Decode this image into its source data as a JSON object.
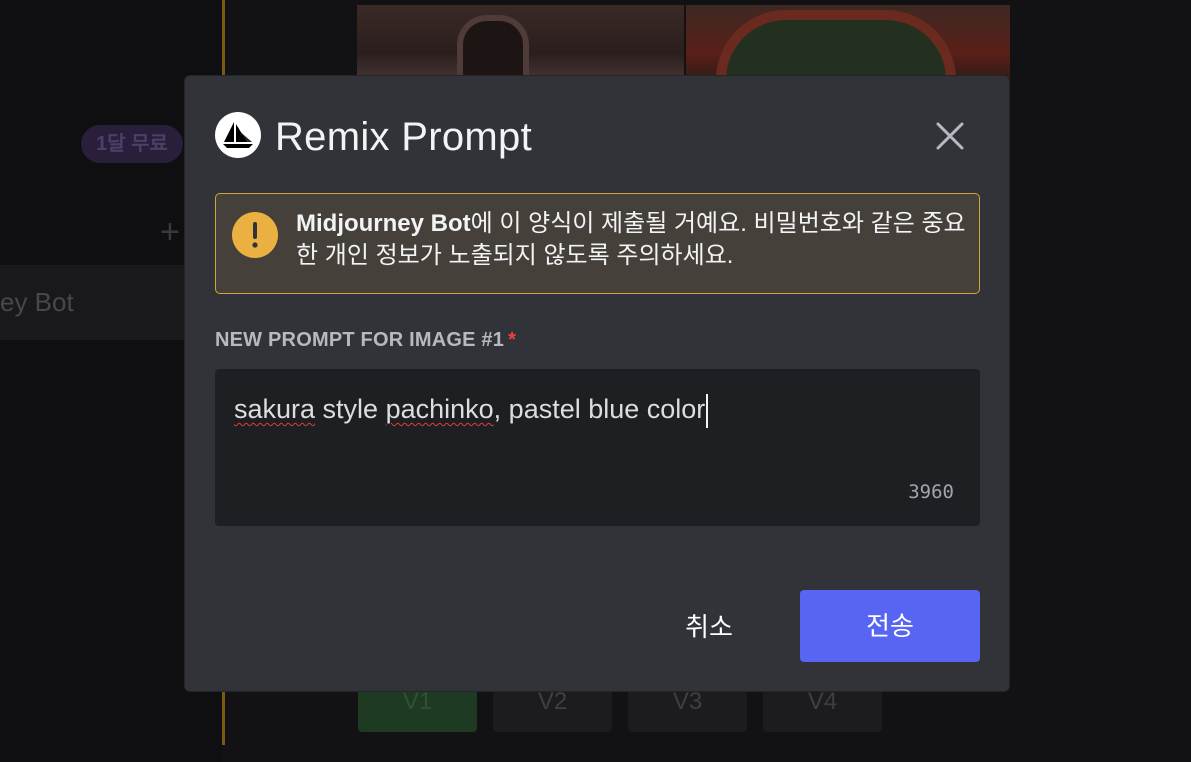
{
  "background": {
    "badge_label": "1달 무료",
    "plus_label": "+",
    "channel_label": "ey Bot",
    "variation_buttons": [
      "V1",
      "V2",
      "V3",
      "V4"
    ]
  },
  "modal": {
    "title": "Remix Prompt",
    "bot_icon": "sailboat-icon",
    "close_icon": "close-icon",
    "warning": {
      "icon": "exclamation-icon",
      "bot_name": "Midjourney Bot",
      "message": "에 이 양식이 제출될 거예요. 비밀번호와 같은 중요한 개인 정보가 노출되지 않도록 주의하세요."
    },
    "field_label": "NEW PROMPT FOR IMAGE #1",
    "required_marker": "*",
    "prompt": {
      "word1": "sakura",
      "text2": " style ",
      "word2": "pachinko",
      "text3": ", pastel blue color"
    },
    "char_count": "3960",
    "cancel_label": "취소",
    "submit_label": "전송"
  },
  "colors": {
    "modal_bg": "#313338",
    "accent": "#5865f2",
    "warning_border": "#d3a33a",
    "warning_icon": "#ebb042",
    "required": "#f23f43"
  }
}
